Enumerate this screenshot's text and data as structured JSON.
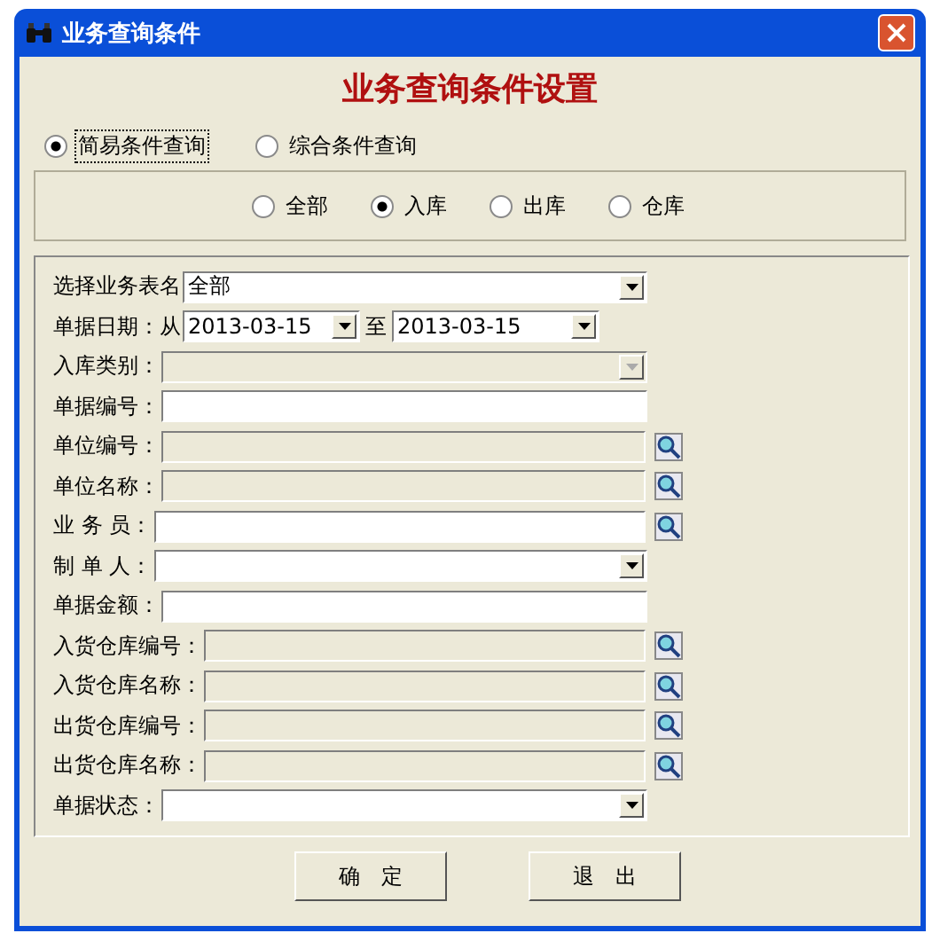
{
  "window": {
    "title": "业务查询条件"
  },
  "heading": "业务查询条件设置",
  "modes": [
    {
      "label": "简易条件查询",
      "selected": true
    },
    {
      "label": "综合条件查询",
      "selected": false
    }
  ],
  "scopes": [
    {
      "label": "全部",
      "selected": false
    },
    {
      "label": "入库",
      "selected": true
    },
    {
      "label": "出库",
      "selected": false
    },
    {
      "label": "仓库",
      "selected": false
    }
  ],
  "fields": [
    {
      "kind": "select",
      "label": "选择业务表名",
      "value": "全部",
      "disabled": false
    },
    {
      "kind": "daterange",
      "label": "单据日期：从",
      "value": "2013-03-15",
      "to_label": "至",
      "to_value": "2013-03-15",
      "disabled": false
    },
    {
      "kind": "select",
      "label": "入库类别：",
      "disabled": true
    },
    {
      "kind": "input",
      "label": "单据编号：",
      "disabled": false
    },
    {
      "kind": "lookup",
      "label": "单位编号：",
      "disabled": true
    },
    {
      "kind": "lookup",
      "label": "单位名称：",
      "disabled": true
    },
    {
      "kind": "lookup",
      "label": "业 务 员：",
      "disabled": false
    },
    {
      "kind": "select",
      "label": "制 单 人：",
      "disabled": false
    },
    {
      "kind": "input",
      "label": "单据金额：",
      "disabled": false
    },
    {
      "kind": "lookup",
      "label": "入货仓库编号：",
      "disabled": true
    },
    {
      "kind": "lookup",
      "label": "入货仓库名称：",
      "disabled": true
    },
    {
      "kind": "lookup",
      "label": "出货仓库编号：",
      "disabled": true
    },
    {
      "kind": "lookup",
      "label": "出货仓库名称：",
      "disabled": true
    },
    {
      "kind": "select",
      "label": "单据状态：",
      "disabled": false
    }
  ],
  "buttons": [
    "确　定",
    "退　出"
  ]
}
